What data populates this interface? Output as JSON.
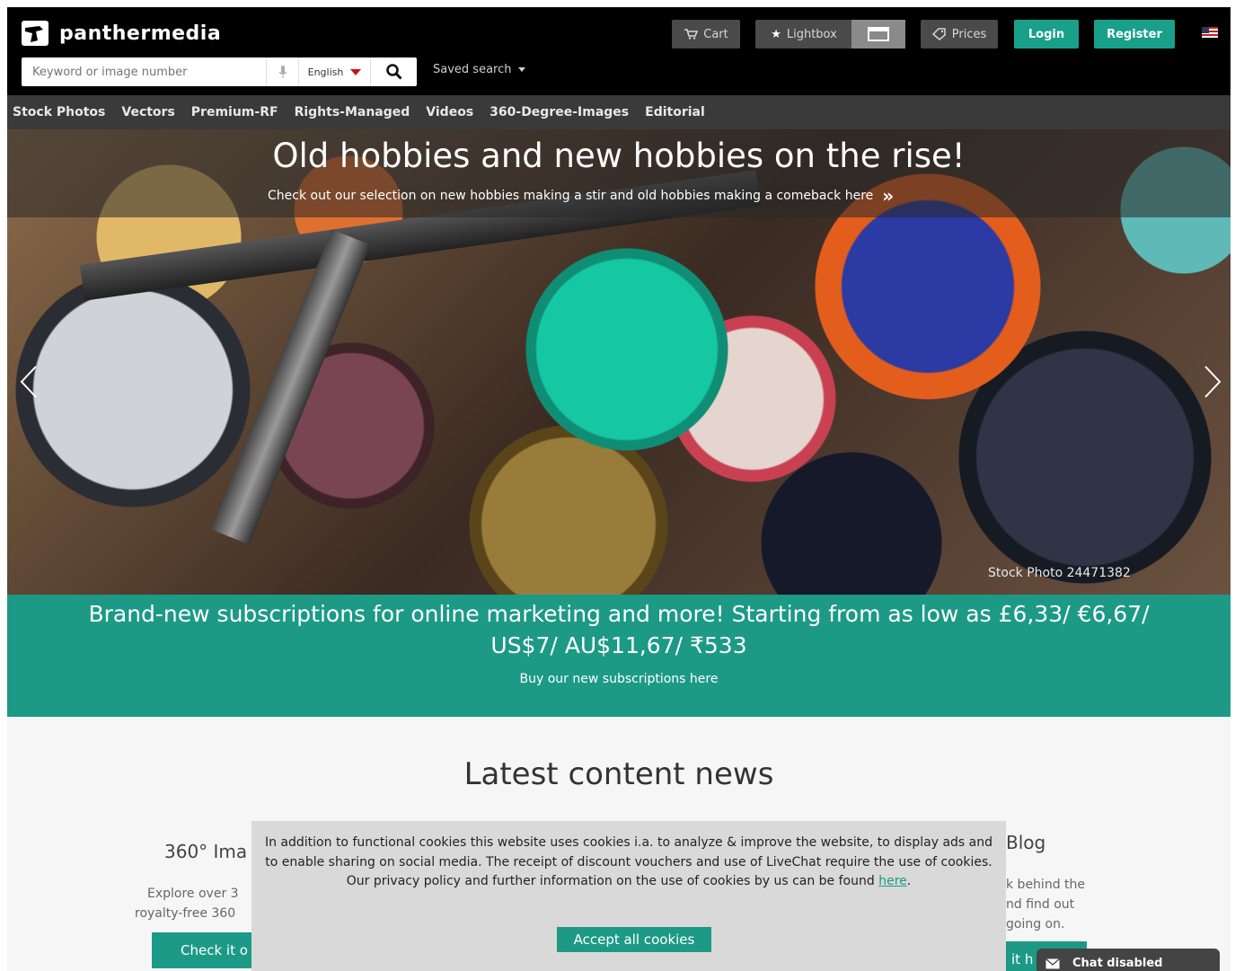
{
  "header": {
    "logo_text": "panthermedia",
    "cart": "Cart",
    "lightbox": "Lightbox",
    "prices": "Prices",
    "login": "Login",
    "register": "Register",
    "search_placeholder": "Keyword or image number",
    "language": "English",
    "saved_search": "Saved search"
  },
  "nav": {
    "items": [
      "Stock Photos",
      "Vectors",
      "Premium-RF",
      "Rights-Managed",
      "Videos",
      "360-Degree-Images",
      "Editorial"
    ]
  },
  "hero": {
    "title": "Old hobbies and new hobbies on the rise!",
    "subtitle": "Check out our selection on new hobbies making a stir and old hobbies making a comeback here",
    "credit": "Stock Photo 24471382"
  },
  "promo": {
    "title": "Brand-new subscriptions for online marketing and more! Starting from as low as £6,33/ €6,67/ US$7/ AU$11,67/ ₹533",
    "link": "Buy our new subscriptions here"
  },
  "news": {
    "title": "Latest content news",
    "card1_heading": "360° Ima",
    "card1_text_1": "Explore over 3",
    "card1_text_2": "royalty-free 360",
    "card1_button": "Check it o",
    "card3_heading": "Blog",
    "card3_text_1": "k behind the",
    "card3_text_2": "nd find out",
    "card3_text_3": "going on.",
    "card3_button": "it h"
  },
  "cookie": {
    "text": "In addition to functional cookies this website uses cookies i.a. to analyze & improve the website, to display ads and to enable sharing on social media. The receipt of discount vouchers and use of LiveChat require the use of cookies. Our privacy policy and further information on the use of cookies by us can be found ",
    "link": "here",
    "end": ".",
    "accept": "Accept all cookies"
  },
  "chat": {
    "label": "Chat disabled"
  }
}
